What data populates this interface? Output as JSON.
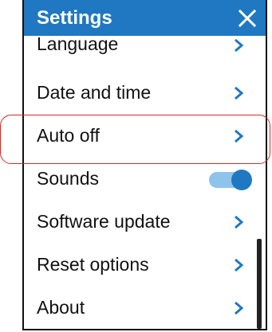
{
  "header": {
    "title": "Settings",
    "close_icon": "close-icon",
    "background_color": "#1f78c1"
  },
  "menu": {
    "items": [
      {
        "label": "Language",
        "control": "chevron"
      },
      {
        "label": "Date and time",
        "control": "chevron"
      },
      {
        "label": "Auto off",
        "control": "chevron",
        "highlighted": true
      },
      {
        "label": "Sounds",
        "control": "toggle",
        "toggle_on": true
      },
      {
        "label": "Software update",
        "control": "chevron"
      },
      {
        "label": "Reset options",
        "control": "chevron"
      },
      {
        "label": "About",
        "control": "chevron"
      }
    ]
  },
  "colors": {
    "accent": "#1f78c1",
    "toggle_track": "#8ec3ec",
    "highlight_outline": "#d12a2a"
  }
}
